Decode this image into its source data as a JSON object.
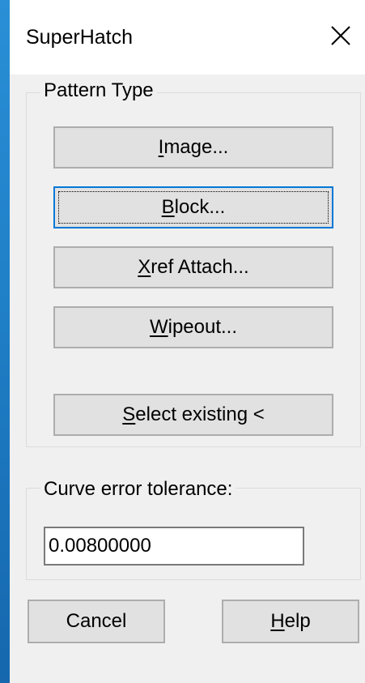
{
  "window": {
    "title": "SuperHatch",
    "close_glyph": "close-icon"
  },
  "pattern_type": {
    "label": "Pattern Type",
    "buttons": [
      {
        "pre": "",
        "key": "I",
        "post": "mage..."
      },
      {
        "pre": "",
        "key": "B",
        "post": "lock..."
      },
      {
        "pre": "",
        "key": "X",
        "post": "ref Attach..."
      },
      {
        "pre": "",
        "key": "W",
        "post": "ipeout..."
      },
      {
        "pre": "",
        "key": "S",
        "post": "elect existing <"
      }
    ]
  },
  "curve": {
    "label": "Curve error tolerance:",
    "value": "0.00800000"
  },
  "footer": {
    "cancel_label": "Cancel",
    "help_pre": "",
    "help_key": "H",
    "help_post": "elp"
  },
  "colors": {
    "desktop_accent": "#1a78c2",
    "dialog_bg": "#f0f0f0",
    "focus_border": "#0078d7"
  }
}
